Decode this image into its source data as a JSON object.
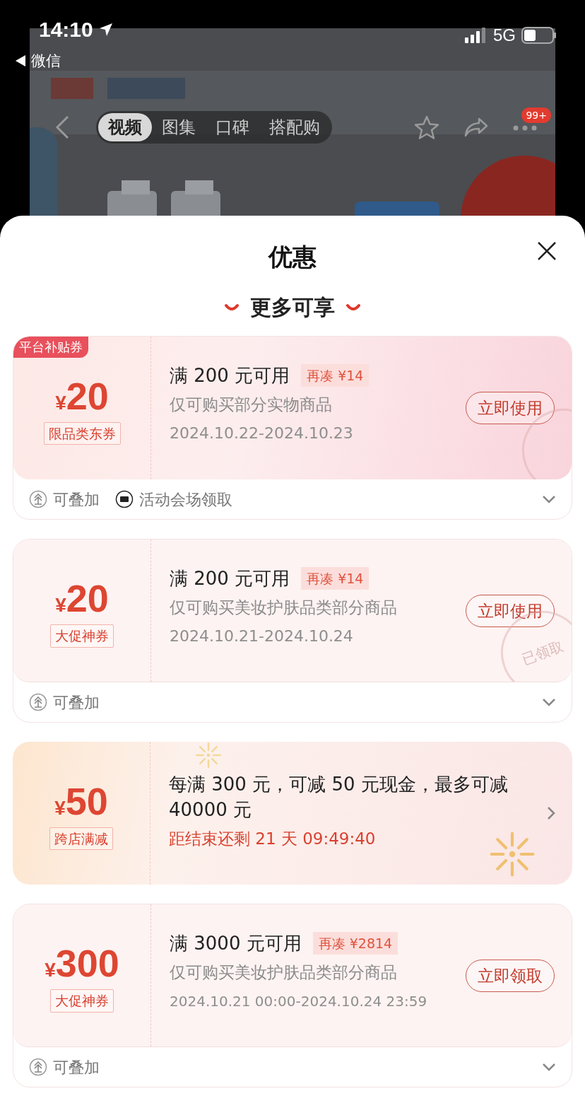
{
  "status_bar": {
    "time": "14:10",
    "back_app": "微信",
    "network": "5G"
  },
  "product_nav": {
    "tabs": [
      {
        "label": "视频",
        "selected": true
      },
      {
        "label": "图集",
        "selected": false
      },
      {
        "label": "口碑",
        "selected": false
      },
      {
        "label": "搭配购",
        "selected": false
      }
    ],
    "notification_badge": "99+"
  },
  "sheet": {
    "title": "优惠",
    "section_title": "更多可享",
    "coupons": [
      {
        "kind": "voucher",
        "corner_tag": "平台补贴券",
        "currency": "¥",
        "amount": "20",
        "type_label": "限品类东券",
        "condition": "满 200 元可用",
        "gap_tag": "再凑 ¥14",
        "scope": "仅可购买部分实物商品",
        "validity": "2024.10.22-2024.10.23",
        "button": "立即使用",
        "stamped": true,
        "expanded": false,
        "footer": [
          {
            "kind": "stack",
            "label": "可叠加"
          },
          {
            "kind": "venue",
            "label": "活动会场领取"
          }
        ]
      },
      {
        "kind": "voucher",
        "currency": "¥",
        "amount": "20",
        "type_label": "大促神券",
        "condition": "满 200 元可用",
        "gap_tag": "再凑 ¥14",
        "scope": "仅可购买美妆护肤品类部分商品",
        "validity": "2024.10.21-2024.10.24",
        "button": "立即使用",
        "stamped": true,
        "stamp_text": "已领取",
        "expanded": false,
        "footer": [
          {
            "kind": "stack",
            "label": "可叠加"
          }
        ]
      },
      {
        "kind": "promo",
        "currency": "¥",
        "amount": "50",
        "type_label": "跨店满减",
        "description": "每满 300 元，可减 50 元现金，最多可减 40000 元",
        "countdown": "距结束还剩 21 天 09:49:40"
      },
      {
        "kind": "voucher",
        "currency": "¥",
        "amount": "300",
        "type_label": "大促神券",
        "condition": "满 3000 元可用",
        "gap_tag": "再凑 ¥2814",
        "scope": "仅可购买美妆护肤品类部分商品",
        "validity": "2024.10.21 00:00-2024.10.24 23:59",
        "button": "立即领取",
        "stamped": false,
        "expanded": false,
        "footer": [
          {
            "kind": "stack",
            "label": "可叠加"
          }
        ]
      }
    ]
  }
}
